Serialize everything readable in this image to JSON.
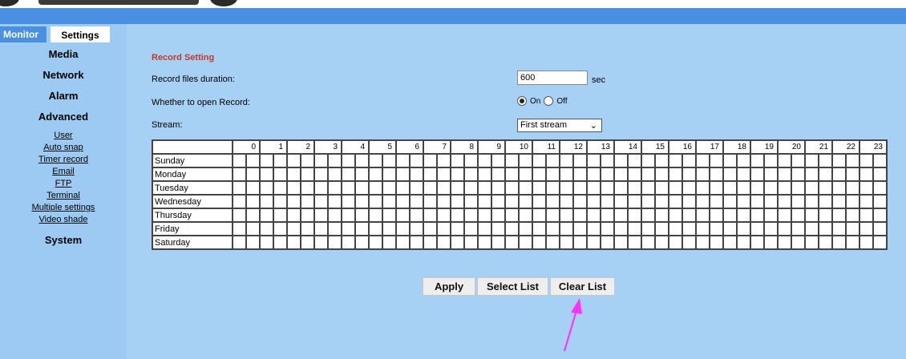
{
  "colors": {
    "accent": "#4a90e0",
    "sidebar_bg": "#9ccaf3",
    "main_bg": "#a7d0f5",
    "title": "#c0392b",
    "arrow": "#ff33ff"
  },
  "tabs": {
    "monitor": "Monitor",
    "settings": "Settings"
  },
  "sidebar": {
    "sections": [
      {
        "label": "Media"
      },
      {
        "label": "Network"
      },
      {
        "label": "Alarm"
      },
      {
        "label": "Advanced",
        "items": [
          "User",
          "Auto snap",
          "Timer record",
          "Email",
          "FTP",
          "Terminal",
          "Multiple settings",
          "Video shade"
        ]
      },
      {
        "label": "System"
      }
    ]
  },
  "record": {
    "title": "Record Setting",
    "duration_label": "Record files duration:",
    "duration_value": "600",
    "duration_unit": "sec",
    "open_label": "Whether to open Record:",
    "on_label": "On",
    "off_label": "Off",
    "selected": "On",
    "stream_label": "Stream:",
    "stream_value": "First stream"
  },
  "schedule": {
    "hours": [
      "0",
      "1",
      "2",
      "3",
      "4",
      "5",
      "6",
      "7",
      "8",
      "9",
      "10",
      "11",
      "12",
      "13",
      "14",
      "15",
      "16",
      "17",
      "18",
      "19",
      "20",
      "21",
      "22",
      "23"
    ],
    "days": [
      "Sunday",
      "Monday",
      "Tuesday",
      "Wednesday",
      "Thursday",
      "Friday",
      "Saturday"
    ]
  },
  "buttons": {
    "apply": "Apply",
    "select_list": "Select List",
    "clear_list": "Clear List"
  },
  "icons": {
    "annotation_arrow": "arrow-annotation-icon",
    "dropdown": "chevron-down-icon"
  }
}
